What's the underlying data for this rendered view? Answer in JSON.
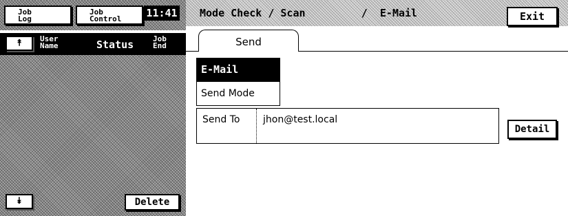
{
  "left_panel": {
    "tabs": {
      "job_log_line1": "Job",
      "job_log_line2": "Log",
      "job_control_line1": "Job",
      "job_control_line2": "Control"
    },
    "clock": "11:41",
    "list_header": {
      "scroll_up_glyph": "⯭",
      "user_name_line1": "User",
      "user_name_line2": "Name",
      "status": "Status",
      "job_end_line1": "Job",
      "job_end_line2": "End"
    },
    "scroll_down_glyph": "⯯",
    "delete_label": "Delete"
  },
  "right_panel": {
    "title": "Mode Check / Scan         /  E-Mail",
    "exit_label": "Exit",
    "tabs": [
      {
        "label": "Send",
        "selected": true
      }
    ],
    "mode_list": [
      {
        "label": "E-Mail",
        "selected": true
      },
      {
        "label": "Send Mode",
        "selected": false
      }
    ],
    "send_to": {
      "label": "Send To",
      "value": "jhon@test.local"
    },
    "detail_label": "Detail"
  },
  "colors": {
    "background": "#ffffff",
    "foreground": "#000000",
    "panel_dither": "#8a8a8a"
  }
}
